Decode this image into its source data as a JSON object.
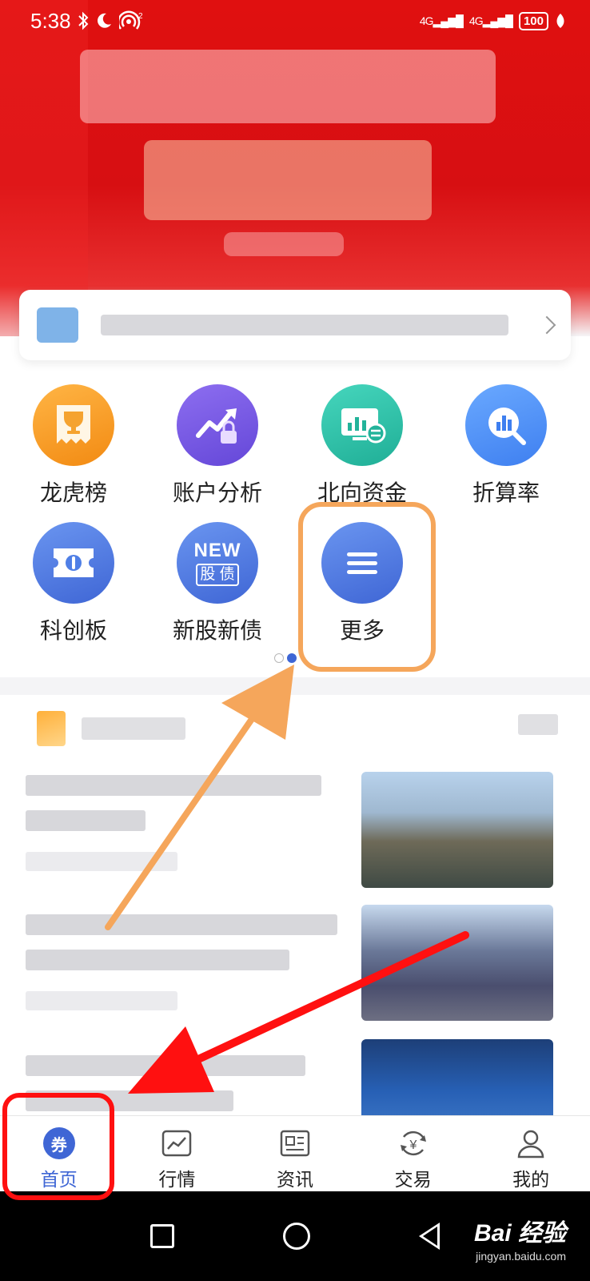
{
  "status_bar": {
    "time": "5:38",
    "signal_1": "4G",
    "signal_2": "4G",
    "battery": "100"
  },
  "shortcuts": [
    {
      "label": "龙虎榜",
      "icon": "trophy-ticket-icon",
      "color": "#f7a02a"
    },
    {
      "label": "账户分析",
      "icon": "trend-chart-lock-icon",
      "color": "#7a5ae6"
    },
    {
      "label": "北向资金",
      "icon": "monitor-exchange-icon",
      "color": "#2fc3a8"
    },
    {
      "label": "折算率",
      "icon": "magnifier-bar-chart-icon",
      "color": "#4c8ef7"
    },
    {
      "label": "科创板",
      "icon": "ticket-icon",
      "color": "#4f7fe6"
    },
    {
      "label": "新股新债",
      "icon": "new-stock-bond-icon",
      "color": "#4f7fe6",
      "badge_top": "NEW",
      "badge_bottom": "股 债"
    },
    {
      "label": "更多",
      "icon": "menu-icon",
      "color": "#4f6fdc"
    }
  ],
  "tabs": [
    {
      "label": "首页",
      "icon": "home-coupon-icon",
      "badge": "券",
      "active": true
    },
    {
      "label": "行情",
      "icon": "market-chart-icon",
      "active": false
    },
    {
      "label": "资讯",
      "icon": "news-icon",
      "active": false
    },
    {
      "label": "交易",
      "icon": "yuan-exchange-icon",
      "badge": "¥",
      "active": false
    },
    {
      "label": "我的",
      "icon": "user-icon",
      "active": false
    }
  ],
  "watermark": {
    "main": "Bai 经验",
    "sub": "jingyan.baidu.com"
  },
  "colors": {
    "accent": "#3f66d5",
    "banner_red": "#e01010",
    "annotation_orange": "#f5a65b",
    "annotation_red": "#ff1010"
  }
}
